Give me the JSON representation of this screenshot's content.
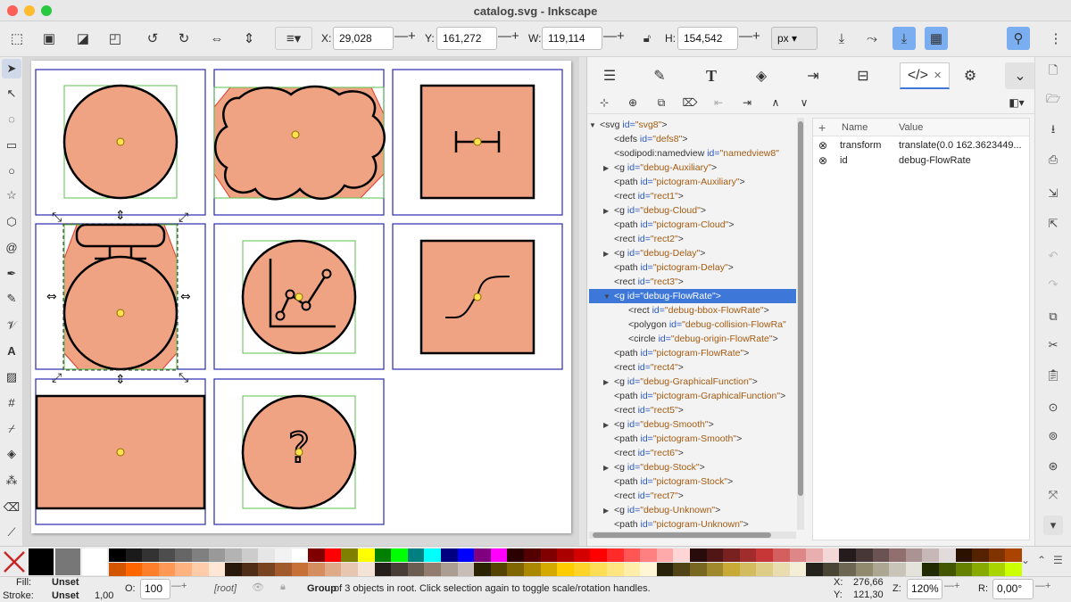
{
  "window": {
    "title": "catalog.svg - Inkscape"
  },
  "commandbar": {
    "x_label": "X:",
    "x_value": "29,028",
    "y_label": "Y:",
    "y_value": "161,272",
    "w_label": "W:",
    "w_value": "119,114",
    "h_label": "H:",
    "h_value": "154,542",
    "unit": "px"
  },
  "xml_tree": [
    {
      "indent": 0,
      "arrow": "down",
      "tag": "svg",
      "id": "svg8"
    },
    {
      "indent": 1,
      "arrow": "",
      "tag": "defs",
      "id": "defs8"
    },
    {
      "indent": 1,
      "arrow": "",
      "tag": "sodipodi:namedview",
      "id": "namedview8"
    },
    {
      "indent": 1,
      "arrow": "right",
      "tag": "g",
      "id": "debug-Auxiliary"
    },
    {
      "indent": 1,
      "arrow": "",
      "tag": "path",
      "id": "pictogram-Auxiliary"
    },
    {
      "indent": 1,
      "arrow": "",
      "tag": "rect",
      "id": "rect1"
    },
    {
      "indent": 1,
      "arrow": "right",
      "tag": "g",
      "id": "debug-Cloud"
    },
    {
      "indent": 1,
      "arrow": "",
      "tag": "path",
      "id": "pictogram-Cloud"
    },
    {
      "indent": 1,
      "arrow": "",
      "tag": "rect",
      "id": "rect2"
    },
    {
      "indent": 1,
      "arrow": "right",
      "tag": "g",
      "id": "debug-Delay"
    },
    {
      "indent": 1,
      "arrow": "",
      "tag": "path",
      "id": "pictogram-Delay"
    },
    {
      "indent": 1,
      "arrow": "",
      "tag": "rect",
      "id": "rect3"
    },
    {
      "indent": 1,
      "arrow": "down",
      "tag": "g",
      "id": "debug-FlowRate",
      "selected": true
    },
    {
      "indent": 2,
      "arrow": "",
      "tag": "rect",
      "id": "debug-bbox-FlowRate"
    },
    {
      "indent": 2,
      "arrow": "",
      "tag": "polygon",
      "id": "debug-collision-FlowRa"
    },
    {
      "indent": 2,
      "arrow": "",
      "tag": "circle",
      "id": "debug-origin-FlowRate"
    },
    {
      "indent": 1,
      "arrow": "",
      "tag": "path",
      "id": "pictogram-FlowRate"
    },
    {
      "indent": 1,
      "arrow": "",
      "tag": "rect",
      "id": "rect4"
    },
    {
      "indent": 1,
      "arrow": "right",
      "tag": "g",
      "id": "debug-GraphicalFunction"
    },
    {
      "indent": 1,
      "arrow": "",
      "tag": "path",
      "id": "pictogram-GraphicalFunction"
    },
    {
      "indent": 1,
      "arrow": "",
      "tag": "rect",
      "id": "rect5"
    },
    {
      "indent": 1,
      "arrow": "right",
      "tag": "g",
      "id": "debug-Smooth"
    },
    {
      "indent": 1,
      "arrow": "",
      "tag": "path",
      "id": "pictogram-Smooth"
    },
    {
      "indent": 1,
      "arrow": "",
      "tag": "rect",
      "id": "rect6"
    },
    {
      "indent": 1,
      "arrow": "right",
      "tag": "g",
      "id": "debug-Stock"
    },
    {
      "indent": 1,
      "arrow": "",
      "tag": "path",
      "id": "pictogram-Stock"
    },
    {
      "indent": 1,
      "arrow": "",
      "tag": "rect",
      "id": "rect7"
    },
    {
      "indent": 1,
      "arrow": "right",
      "tag": "g",
      "id": "debug-Unknown"
    },
    {
      "indent": 1,
      "arrow": "",
      "tag": "path",
      "id": "pictogram-Unknown"
    }
  ],
  "attributes": {
    "name_header": "Name",
    "value_header": "Value",
    "rows": [
      {
        "name": "transform",
        "value": "translate(0.0 162.3623449..."
      },
      {
        "name": "id",
        "value": "debug-FlowRate"
      }
    ]
  },
  "statusbar": {
    "fill_label": "Fill:",
    "fill_value": "Unset",
    "stroke_label": "Stroke:",
    "stroke_value": "Unset",
    "stroke_width": "1,00",
    "opacity_label": "O:",
    "opacity_value": "100",
    "layer": "[root]",
    "message_bold": "Group",
    "message": " of 3 objects in root. Click selection again to toggle scale/rotation handles.",
    "cursor_x_label": "X:",
    "cursor_x": "276,66",
    "cursor_y_label": "Y:",
    "cursor_y": "121,30",
    "zoom_label": "Z:",
    "zoom": "120%",
    "rotation_label": "R:",
    "rotation": "0,00°"
  },
  "colors": {
    "shape_fill": "#f0a383",
    "frame_blue": "#2a2ab0",
    "bbox_green": "#5cbf4f",
    "accent_blue": "#3d77d8"
  },
  "palette_row1": [
    "#000000",
    "#1a1a1a",
    "#333333",
    "#4d4d4d",
    "#666666",
    "#808080",
    "#999999",
    "#b3b3b3",
    "#cccccc",
    "#e6e6e6",
    "#f2f2f2",
    "#ffffff",
    "#800000",
    "#ff0000",
    "#808000",
    "#ffff00",
    "#008000",
    "#00ff00",
    "#008080",
    "#00ffff",
    "#000080",
    "#0000ff",
    "#800080",
    "#ff00ff",
    "#2b0000",
    "#550000",
    "#800000",
    "#aa0000",
    "#d40000",
    "#ff0000",
    "#ff2a2a",
    "#ff5555",
    "#ff8080",
    "#ffaaaa",
    "#ffd5d5",
    "#280b0b",
    "#501616",
    "#782121",
    "#a02c2c",
    "#c83737",
    "#d35f5f",
    "#de8787",
    "#e9afaf",
    "#f4d7d7",
    "#241c1c",
    "#483737",
    "#6c5353",
    "#916f6f",
    "#ac9393",
    "#c8b7b7",
    "#e3dbdb",
    "#2b1100",
    "#552200",
    "#803300",
    "#aa4400"
  ],
  "palette_row2": [
    "#d45500",
    "#ff6600",
    "#ff7f2a",
    "#ff9955",
    "#ffb380",
    "#ffccaa",
    "#ffe6d5",
    "#28170b",
    "#502d16",
    "#784421",
    "#a05a2c",
    "#c87137",
    "#d38d5f",
    "#deaa87",
    "#e9c6af",
    "#f4e3d7",
    "#241f1c",
    "#483e37",
    "#6c5d53",
    "#917c6f",
    "#ac9d93",
    "#c8beb7",
    "#2b2200",
    "#554400",
    "#806600",
    "#aa8800",
    "#d4aa00",
    "#ffcc00",
    "#ffd42a",
    "#ffdd55",
    "#ffe680",
    "#ffeeaa",
    "#fff6d5",
    "#28220b",
    "#504416",
    "#786721",
    "#a0892c",
    "#c8ab37",
    "#d3bc5f",
    "#decd87",
    "#e9ddaf",
    "#f4eed7",
    "#24221c",
    "#484537",
    "#6c6753",
    "#918a6f",
    "#aca793",
    "#c8c4b7",
    "#e3e2db",
    "#222b00",
    "#445500",
    "#668000",
    "#88aa00",
    "#aad400",
    "#ccff00"
  ]
}
